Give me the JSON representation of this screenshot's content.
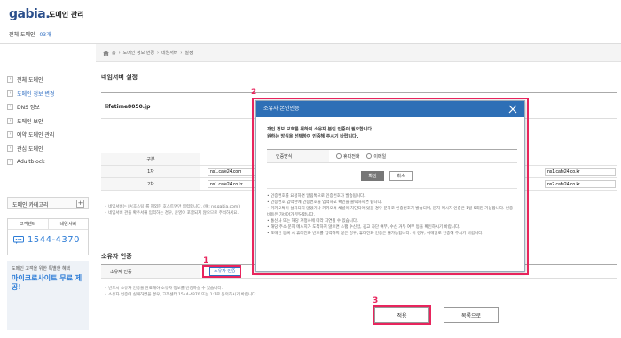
{
  "header": {
    "logo": "gabia.",
    "title": "도메인 관리",
    "domain_count_label": "전체 도메인",
    "domain_count": "03개"
  },
  "breadcrumb": [
    "홈",
    "도메인 정보 변경",
    "네임서버",
    "설정"
  ],
  "sidebar": {
    "items": [
      {
        "label": "전체 도메인"
      },
      {
        "label": "도메인 정보 변경",
        "active": true
      },
      {
        "label": "DNS 정보"
      },
      {
        "label": "도메인 보안"
      },
      {
        "label": "예약 도메인 관리"
      },
      {
        "label": "관심 도메인"
      },
      {
        "label": "Adultblock"
      }
    ],
    "category_label": "도메인 카테고리",
    "cs_tabs": [
      "고객센터",
      "네임서버"
    ],
    "cs_number": "1544-4370",
    "ad_sub": "도메인 고객을 위한 특별한 혜택",
    "ad_title": "마이크로사이트 무료 제공!"
  },
  "main": {
    "ns_title": "네임서버 설정",
    "domain": "lifetime8050.jp",
    "ns_header_label": "구분",
    "ns_rows": [
      {
        "label": "1차",
        "left": "ns1.cafe24.com",
        "right": "ns1.cafe24.co.kr"
      },
      {
        "label": "2차",
        "left": "ns1.cafe24.co.kr",
        "right": "ns2.cafe24.co.kr"
      }
    ],
    "ns_notes": [
      "네임서버는 IP(호스팅)를 제외한 호스트명만 입력합니다. (예: ns.gabia.com)",
      "네임서버 관을 확주서해 입력하는 경우, 운영이 포함되지 않으므로 주의하세요."
    ],
    "owner_title": "소유자 인증",
    "owner_label": "소유자 인증",
    "owner_button": "소유자 인증",
    "owner_notes": [
      "반드시 소유자 인증을 완료해야 소유자 정보를 변경하실 수 있습니다.",
      "소유자 인증에 실패하였을 경우, 고객센터 1544-4370 또는 1:1로 문의하시기 바랍니다."
    ],
    "apply_button": "적용",
    "list_button": "목록으로"
  },
  "modal": {
    "title": "소유자 본인인증",
    "desc_line1": "개인 정보 보호를 위하여 소유자 본인 인증이 필요합니다.",
    "desc_line2": "원하는 방식을 선택하여 인증해 주시기 바랍니다.",
    "auth_label": "인증방식",
    "option_phone": "휴대전화",
    "option_email": "이메일",
    "confirm": "확인",
    "cancel": "취소",
    "notes": [
      "인증번호를 요청하면 알림톡으로 인증번호가 발송됩니다.",
      "인증번호 입력란에 인증번호를 입력하고 확인을 클릭하시면 됩니다.",
      "카카오톡이 설치되지 않았거나 카카오톡 채널이 차단되어 있을 경우 문자로 인증번호가 발송되며, 문자 메시지 인증은 1일 5회만 가능합니다. 인증 비용은 가비아가 부담합니다.",
      "통신사 또는 해당 계정사에 따라 지연될 수 있습니다.",
      "해당 주소 문자 메시지가 도착하지 않으면 스팸 수신함, 광고 차단 여부, 수신 거부 여부 등을 확인하시기 바랍니다.",
      "도메인 등록 시 휴대전화 번호를 입력하지 않은 경우, 휴대전화 인증은 불가능합니다. 이 경우, 이메일로 인증해 주시기 바랍니다."
    ]
  },
  "annotations": [
    "1",
    "2",
    "3"
  ],
  "colors": {
    "accent": "#2e6fb6",
    "annotation": "#e8255d",
    "link": "#2f6ec2"
  }
}
